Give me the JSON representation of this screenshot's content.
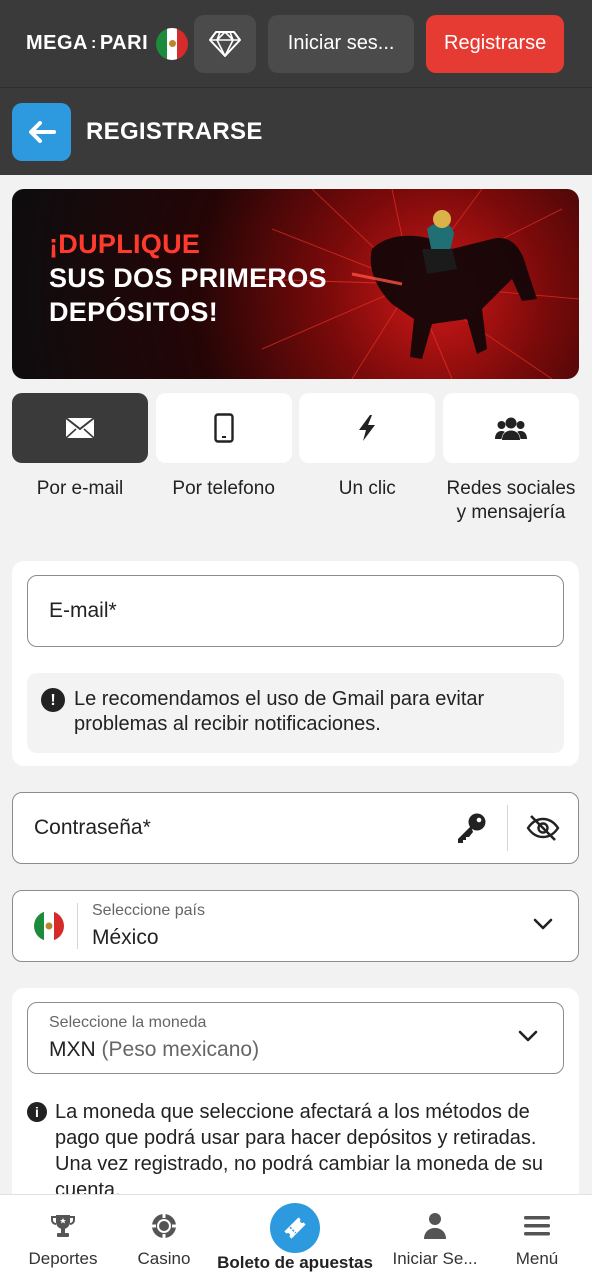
{
  "header": {
    "logo_left": "MEGA",
    "logo_sep": ":",
    "logo_right": "PARI",
    "login_label": "Iniciar ses...",
    "register_label": "Registrarse"
  },
  "subheader": {
    "title": "REGISTRARSE"
  },
  "banner": {
    "line1": "¡DUPLIQUE",
    "line2": "SUS DOS PRIMEROS",
    "line3": "DEPÓSITOS!"
  },
  "tabs": [
    {
      "label": "Por e-mail",
      "icon": "envelope-icon",
      "active": true
    },
    {
      "label": "Por telefono",
      "icon": "phone-icon",
      "active": false
    },
    {
      "label": "Un clic",
      "icon": "lightning-icon",
      "active": false
    },
    {
      "label": "Redes sociales y mensajería",
      "icon": "users-icon",
      "active": false
    }
  ],
  "form": {
    "email_placeholder": "E-mail*",
    "email_hint": "Le recomendamos el uso de Gmail para evitar problemas al recibir notificaciones.",
    "password_placeholder": "Contraseña*",
    "country_label": "Seleccione país",
    "country_value": "México",
    "currency_label": "Seleccione la moneda",
    "currency_code": "MXN",
    "currency_name": "(Peso mexicano)",
    "currency_note": "La moneda que seleccione afectará a los métodos de pago que podrá usar para hacer depósitos y retiradas. Una vez registrado, no podrá cambiar la moneda de su cuenta."
  },
  "bottom_nav": [
    {
      "label": "Deportes",
      "icon": "trophy-icon"
    },
    {
      "label": "Casino",
      "icon": "casino-chip-icon"
    },
    {
      "label": "Boleto de apuestas",
      "icon": "ticket-icon"
    },
    {
      "label": "Iniciar Se...",
      "icon": "user-icon"
    },
    {
      "label": "Menú",
      "icon": "menu-icon"
    }
  ],
  "colors": {
    "header_bg": "#3a3a3a",
    "accent_red": "#e63b33",
    "accent_blue": "#2d9ae0",
    "page_bg": "#f2f2f2"
  }
}
